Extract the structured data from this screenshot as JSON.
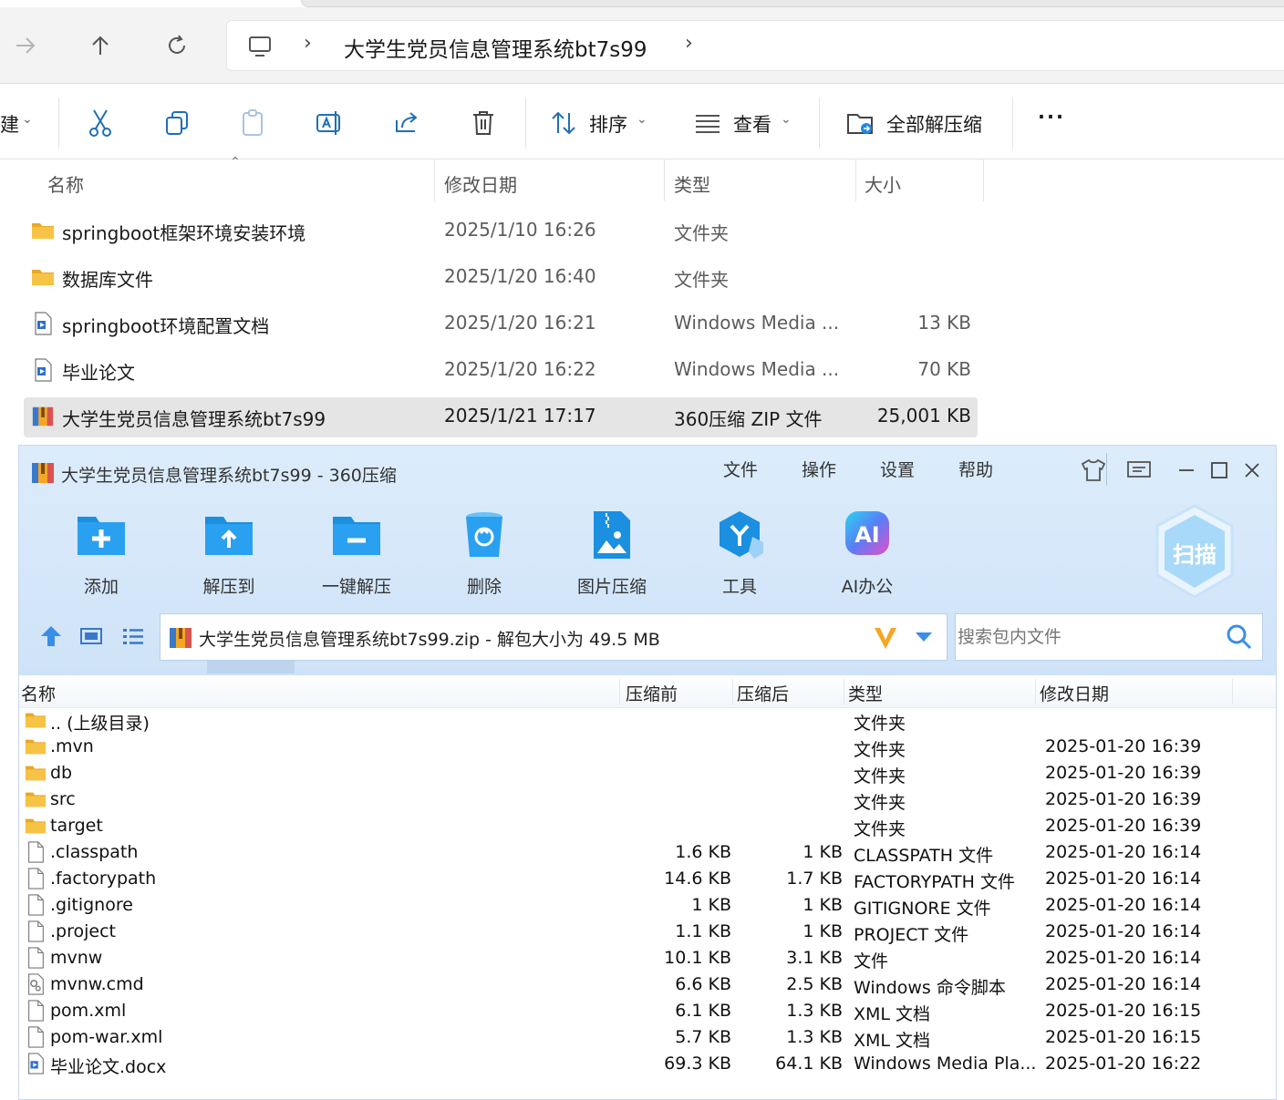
{
  "explorer": {
    "address": "大学生党员信息管理系统bt7s99",
    "toolbar": {
      "new_partial": "建",
      "sort_label": "排序",
      "view_label": "查看",
      "extract_all_label": "全部解压缩",
      "more_label": "..."
    },
    "columns": {
      "name": "名称",
      "modified": "修改日期",
      "type": "类型",
      "size": "大小"
    },
    "rows": [
      {
        "name": "springboot框架环境安装环境",
        "modified": "2025/1/10 16:26",
        "type": "文件夹",
        "size": "",
        "icon": "folder-icon"
      },
      {
        "name": "数据库文件",
        "modified": "2025/1/20 16:40",
        "type": "文件夹",
        "size": "",
        "icon": "folder-icon"
      },
      {
        "name": "springboot环境配置文档",
        "modified": "2025/1/20 16:21",
        "type": "Windows Media ...",
        "size": "13 KB",
        "icon": "media-file-icon"
      },
      {
        "name": "毕业论文",
        "modified": "2025/1/20 16:22",
        "type": "Windows Media ...",
        "size": "70 KB",
        "icon": "media-file-icon"
      },
      {
        "name": "大学生党员信息管理系统bt7s99",
        "modified": "2025/1/21 17:17",
        "type": "360压缩 ZIP 文件",
        "size": "25,001 KB",
        "icon": "zip-archive-icon"
      }
    ]
  },
  "archiver": {
    "title": "大学生党员信息管理系统bt7s99 - 360压缩",
    "menu": [
      "文件",
      "操作",
      "设置",
      "帮助"
    ],
    "tools": [
      "添加",
      "解压到",
      "一键解压",
      "删除",
      "图片压缩",
      "工具",
      "AI办公"
    ],
    "ai_badge": "AI",
    "scan_label": "扫描",
    "path_text": "大学生党员信息管理系统bt7s99.zip - 解包大小为 49.5 MB",
    "search_placeholder": "搜索包内文件",
    "columns": {
      "name": "名称",
      "before": "压缩前",
      "after": "压缩后",
      "type": "类型",
      "modified": "修改日期"
    },
    "rows": [
      {
        "name": ".. (上级目录)",
        "before": "",
        "after": "",
        "type": "文件夹",
        "modified": "",
        "icon": "folder-icon"
      },
      {
        "name": ".mvn",
        "before": "",
        "after": "",
        "type": "文件夹",
        "modified": "2025-01-20 16:39",
        "icon": "folder-icon"
      },
      {
        "name": "db",
        "before": "",
        "after": "",
        "type": "文件夹",
        "modified": "2025-01-20 16:39",
        "icon": "folder-icon"
      },
      {
        "name": "src",
        "before": "",
        "after": "",
        "type": "文件夹",
        "modified": "2025-01-20 16:39",
        "icon": "folder-icon"
      },
      {
        "name": "target",
        "before": "",
        "after": "",
        "type": "文件夹",
        "modified": "2025-01-20 16:39",
        "icon": "folder-icon"
      },
      {
        "name": ".classpath",
        "before": "1.6 KB",
        "after": "1 KB",
        "type": "CLASSPATH 文件",
        "modified": "2025-01-20 16:14",
        "icon": "file-icon"
      },
      {
        "name": ".factorypath",
        "before": "14.6 KB",
        "after": "1.7 KB",
        "type": "FACTORYPATH 文件",
        "modified": "2025-01-20 16:14",
        "icon": "file-icon"
      },
      {
        "name": ".gitignore",
        "before": "1 KB",
        "after": "1 KB",
        "type": "GITIGNORE 文件",
        "modified": "2025-01-20 16:14",
        "icon": "file-icon"
      },
      {
        "name": ".project",
        "before": "1.1 KB",
        "after": "1 KB",
        "type": "PROJECT 文件",
        "modified": "2025-01-20 16:14",
        "icon": "file-icon"
      },
      {
        "name": "mvnw",
        "before": "10.1 KB",
        "after": "3.1 KB",
        "type": "文件",
        "modified": "2025-01-20 16:14",
        "icon": "file-icon"
      },
      {
        "name": "mvnw.cmd",
        "before": "6.6 KB",
        "after": "2.5 KB",
        "type": "Windows 命令脚本",
        "modified": "2025-01-20 16:14",
        "icon": "cmd-script-icon"
      },
      {
        "name": "pom.xml",
        "before": "6.1 KB",
        "after": "1.3 KB",
        "type": "XML 文档",
        "modified": "2025-01-20 16:15",
        "icon": "file-icon"
      },
      {
        "name": "pom-war.xml",
        "before": "5.7 KB",
        "after": "1.3 KB",
        "type": "XML 文档",
        "modified": "2025-01-20 16:15",
        "icon": "file-icon"
      },
      {
        "name": "毕业论文.docx",
        "before": "69.3 KB",
        "after": "64.1 KB",
        "type": "Windows Media Pla...",
        "modified": "2025-01-20 16:22",
        "icon": "media-file-icon"
      }
    ]
  },
  "colors": {
    "folder": "#f6c344",
    "accent_blue": "#1e88e5",
    "selected_row": "#e5e5e5",
    "archiver_head": "#d6e8fa"
  }
}
